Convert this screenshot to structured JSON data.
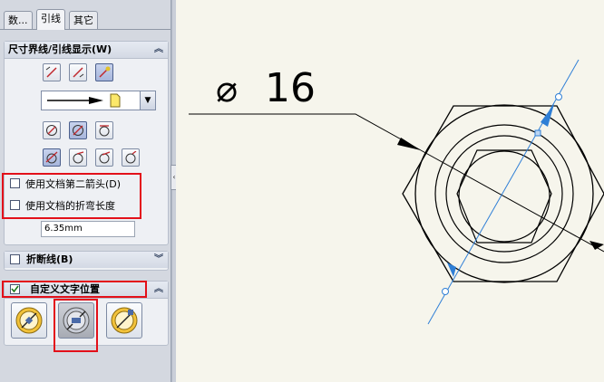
{
  "tabs": [
    {
      "label": "数..."
    },
    {
      "label": "引线"
    },
    {
      "label": "其它"
    }
  ],
  "groups": {
    "leader_display": {
      "title": "尺寸界线/引线显示(W)",
      "checkbox_second_arrow": "使用文档第二箭头(D)",
      "checkbox_bend_length": "使用文档的折弯长度",
      "bend_length_value": "6.35mm"
    },
    "break_line": {
      "title": "折断线(B)"
    },
    "custom_text_position": {
      "title": "自定义文字位置"
    }
  },
  "drawing": {
    "dimension_text": "16",
    "diameter_symbol": "⌀"
  },
  "colors": {
    "highlight": "#e3101a",
    "drawing_line": "#000000",
    "selection_blue": "#2f7fd6",
    "paper": "#f6f5ec"
  }
}
